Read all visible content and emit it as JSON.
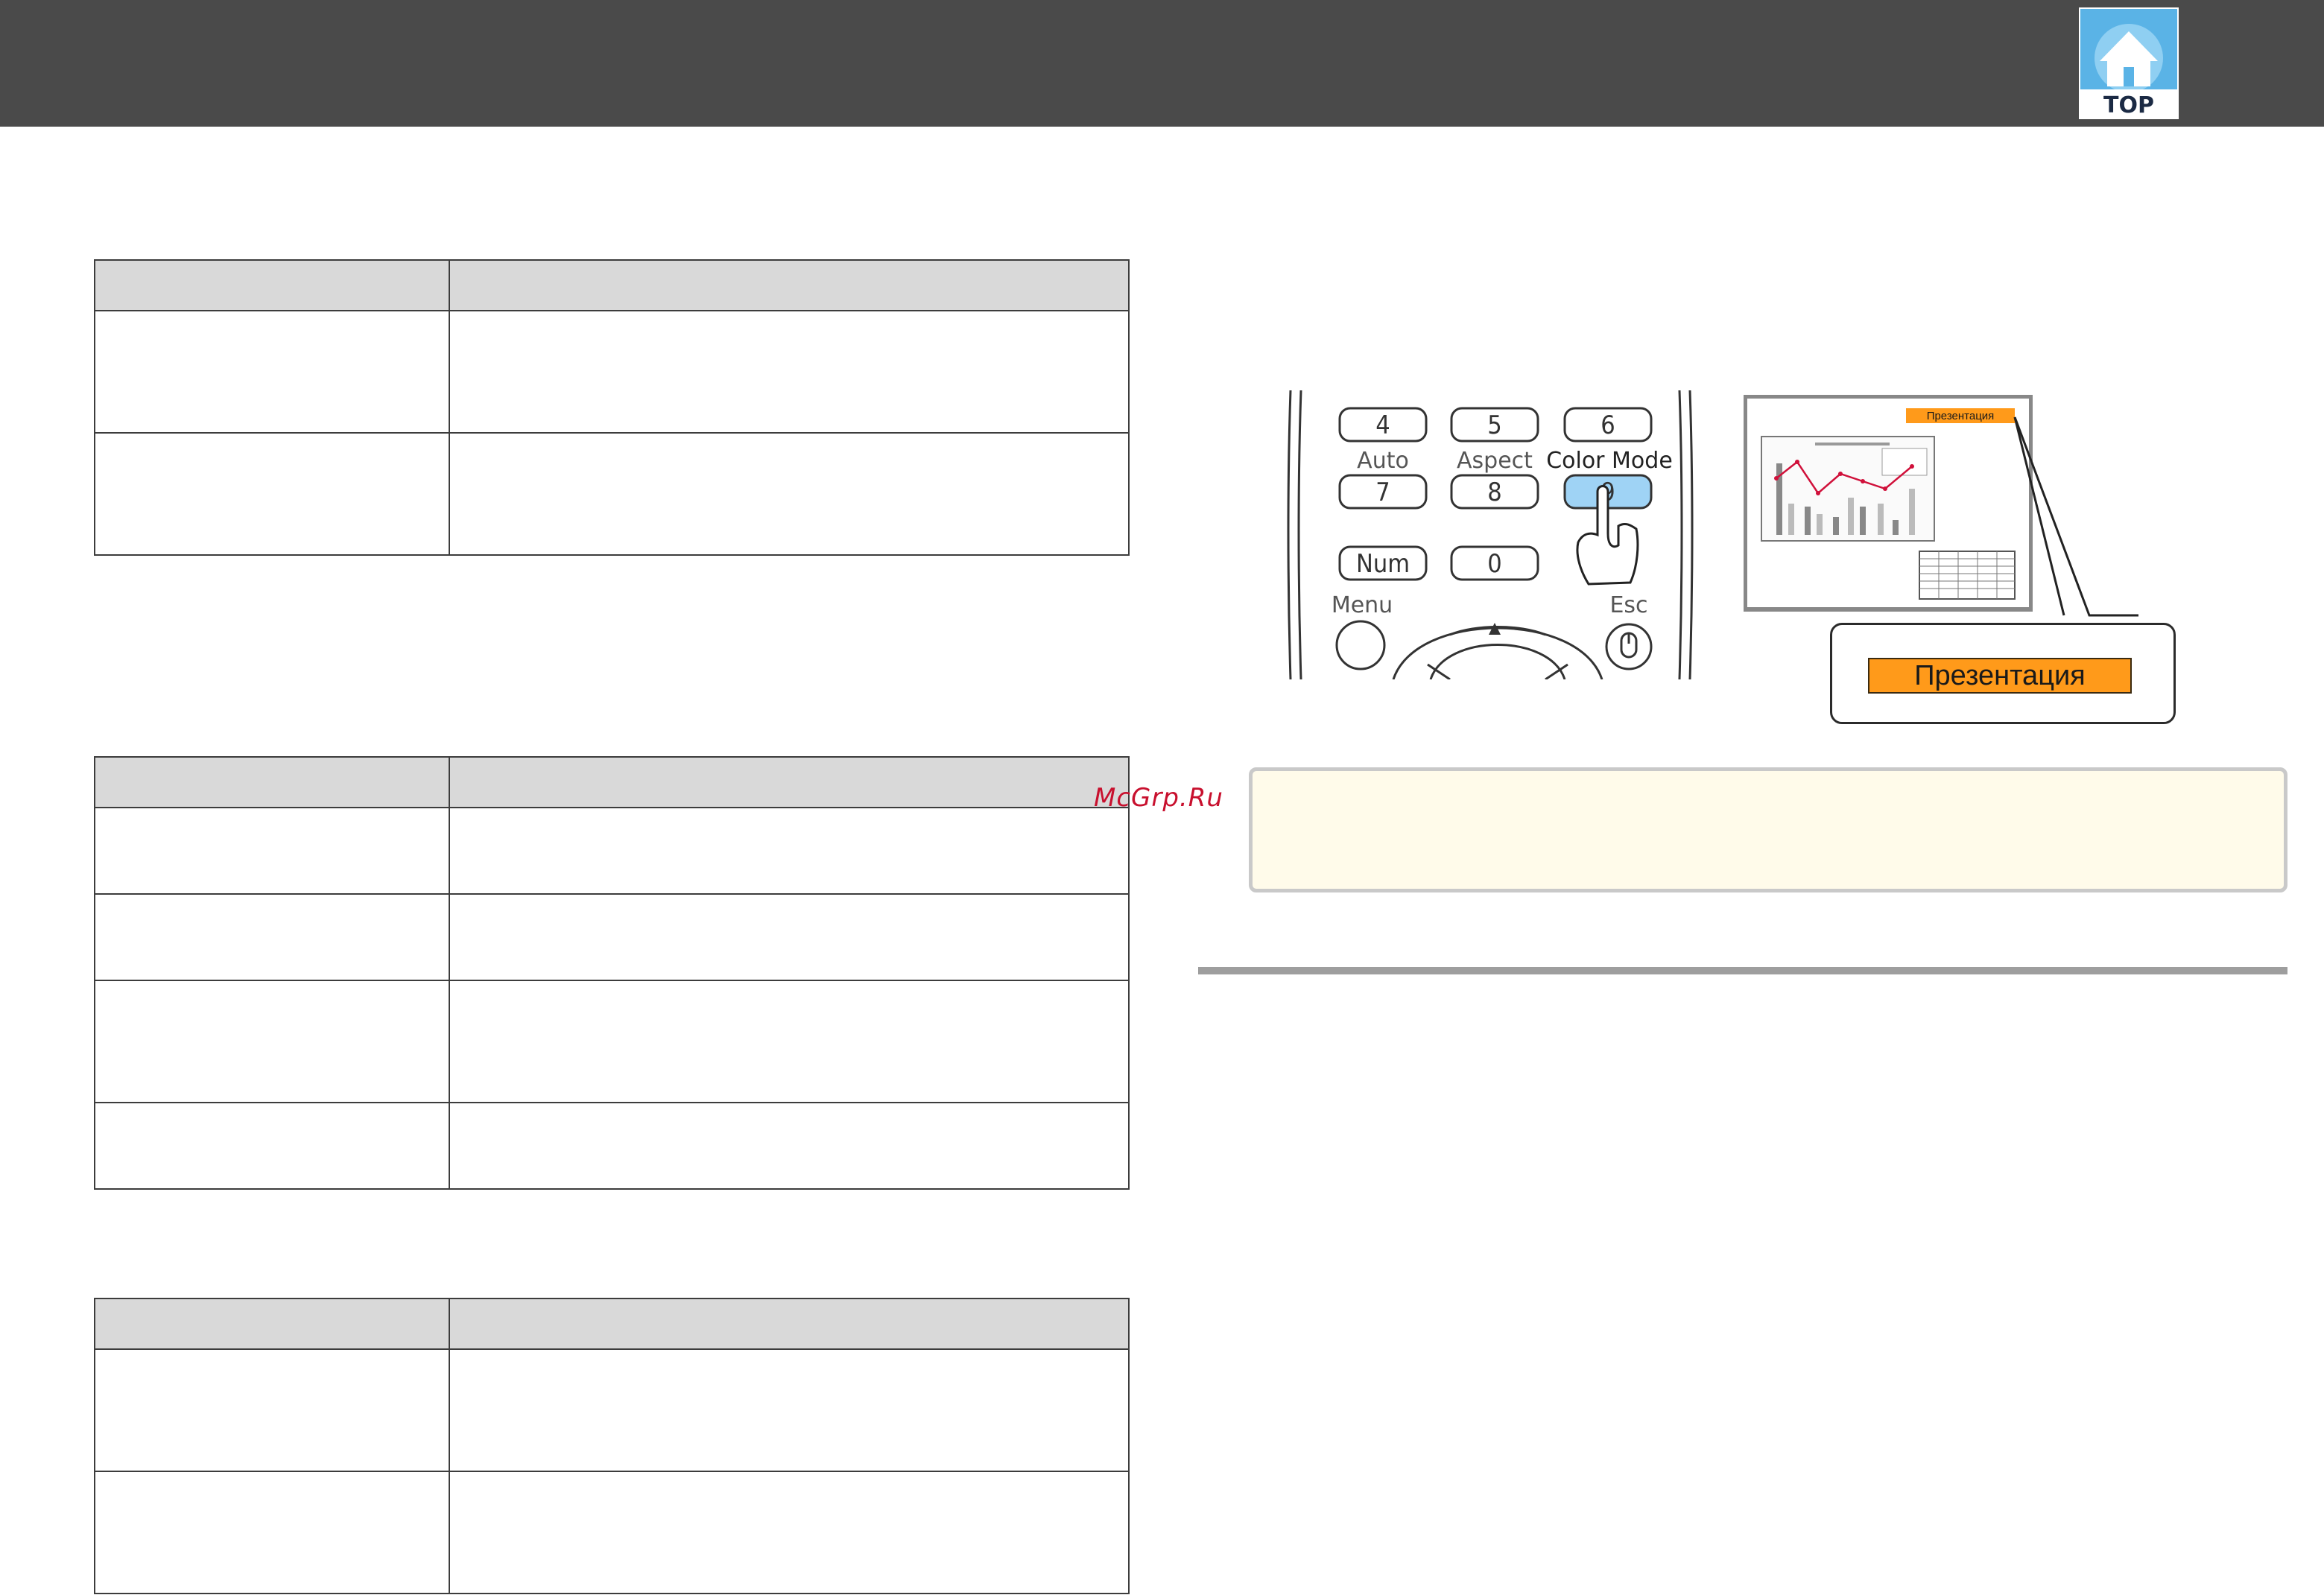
{
  "header": {
    "top_button_label": "TOP"
  },
  "watermark": "McGrp.Ru",
  "remote_control": {
    "keys": {
      "key_4": "4",
      "key_5": "5",
      "key_6": "6",
      "key_7": "7",
      "key_8": "8",
      "key_9": "9",
      "key_num": "Num",
      "key_0": "0"
    },
    "labels": {
      "auto": "Auto",
      "aspect": "Aspect",
      "color_mode": "Color Mode",
      "menu": "Menu",
      "esc": "Esc"
    }
  },
  "projected_screen": {
    "mode_badge": "Презентация"
  },
  "callout": {
    "mode_label": "Презентация"
  },
  "colors": {
    "header_bar": "#4a4a4a",
    "badge_orange": "#ff9a1a",
    "highlighted_key": "#9fd3f5",
    "note_background": "#fffbea",
    "graph_line": "#d0103a"
  }
}
